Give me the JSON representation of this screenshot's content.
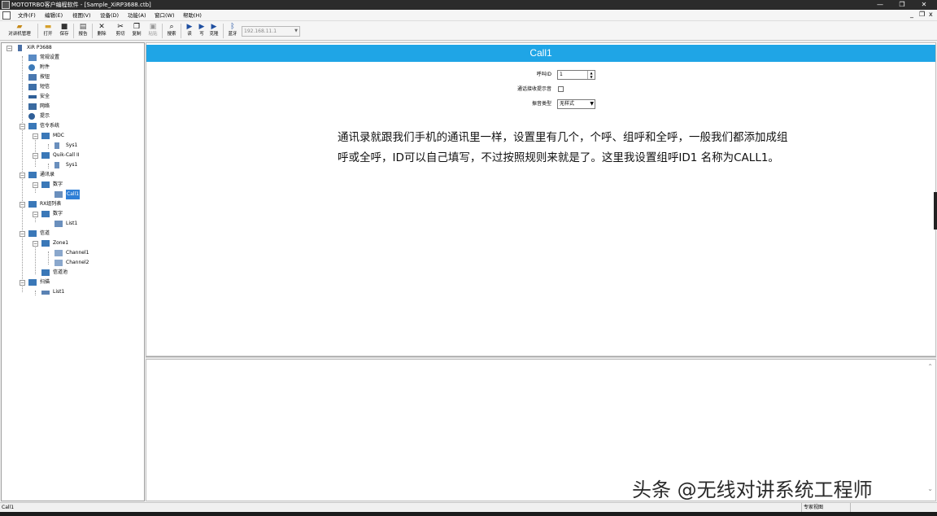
{
  "window": {
    "title": "MOTOTRBO客户编程软件 - [Sample_XiRP3688.ctb]",
    "minimize": "—",
    "restore": "❐",
    "close": "✕"
  },
  "menubar": {
    "items": [
      "文件(F)",
      "编辑(E)",
      "视图(V)",
      "设备(D)",
      "功能(A)",
      "窗口(W)",
      "帮助(H)"
    ],
    "mdi_minimize": "_",
    "mdi_restore": "❐",
    "mdi_close": "x"
  },
  "toolbar": {
    "buttons": [
      "对讲机管理",
      "打开",
      "保存",
      "报告",
      "删除",
      "剪切",
      "复制",
      "粘贴",
      "搜索",
      "读",
      "写",
      "克隆",
      "蓝牙"
    ],
    "ip_address": "192.168.11.1"
  },
  "tree": {
    "nodes": [
      {
        "label": "XiR P3688"
      },
      {
        "label": "常规设置"
      },
      {
        "label": "附件"
      },
      {
        "label": "按钮"
      },
      {
        "label": "短信"
      },
      {
        "label": "安全"
      },
      {
        "label": "网络"
      },
      {
        "label": "提示"
      },
      {
        "label": "信令系统"
      },
      {
        "label": "MDC"
      },
      {
        "label": "Sys1"
      },
      {
        "label": "Quik-Call II"
      },
      {
        "label": "Sys1"
      },
      {
        "label": "通讯录"
      },
      {
        "label": "数字"
      },
      {
        "label": "Call1"
      },
      {
        "label": "RX组列表"
      },
      {
        "label": "数字"
      },
      {
        "label": "List1"
      },
      {
        "label": "信道"
      },
      {
        "label": "Zone1"
      },
      {
        "label": "Channel1"
      },
      {
        "label": "Channel2"
      },
      {
        "label": "信道池"
      },
      {
        "label": "扫描"
      },
      {
        "label": "List1"
      }
    ]
  },
  "editor": {
    "header": "Call1",
    "fields": {
      "call_id_label": "呼叫ID",
      "call_id_value": "1",
      "receive_tone_label": "通话接收提示音",
      "ring_style_label": "振音类型",
      "ring_style_value": "无样式"
    },
    "note": "通讯录就跟我们手机的通讯里一样，设置里有几个，个呼、组呼和全呼，一般我们都添加成组呼或全呼，ID可以自己填写，不过按照规则来就是了。这里我设置组呼ID1 名称为CALL1。"
  },
  "watermark": "头条 @无线对讲系统工程师",
  "statusbar": {
    "left": "Call1",
    "mode": "专家视图"
  }
}
